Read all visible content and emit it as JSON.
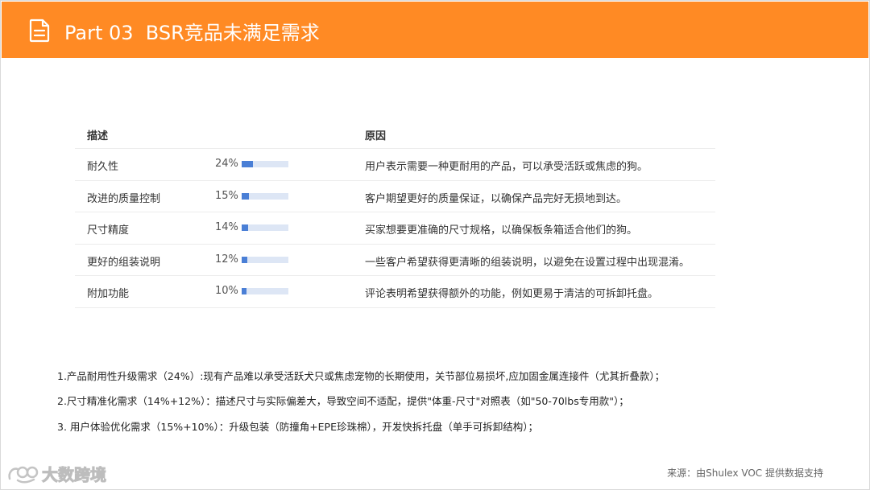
{
  "header": {
    "title": "Part 03  BSR竞品未满足需求"
  },
  "table": {
    "headers": {
      "description": "描述",
      "reason": "原因"
    },
    "rows": [
      {
        "name": "耐久性",
        "percent_label": "24%",
        "fraction": 0.24,
        "reason": "用户表示需要一种更耐用的产品，可以承受活跃或焦虑的狗。"
      },
      {
        "name": "改进的质量控制",
        "percent_label": "15%",
        "fraction": 0.15,
        "reason": "客户期望更好的质量保证，以确保产品完好无损地到达。"
      },
      {
        "name": "尺寸精度",
        "percent_label": "14%",
        "fraction": 0.14,
        "reason": "买家想要更准确的尺寸规格，以确保板条箱适合他们的狗。"
      },
      {
        "name": "更好的组装说明",
        "percent_label": "12%",
        "fraction": 0.12,
        "reason": "一些客户希望获得更清晰的组装说明，以避免在设置过程中出现混淆。"
      },
      {
        "name": "附加功能",
        "percent_label": "10%",
        "fraction": 0.1,
        "reason": "评论表明希望获得额外的功能，例如更易于清洁的可拆卸托盘。"
      }
    ]
  },
  "notes": [
    "1.产品耐用性升级需求（24%）:现有产品难以承受活跃犬只或焦虑宠物的长期使用，关节部位易损坏,应加固金属连接件（尤其折叠款）；",
    "2.尺寸精准化需求（14%+12%）：描述尺寸与实际偏差大，导致空间不适配，提供\"体重-尺寸\"对照表（如\"50-70lbs专用款\"）；",
    "3. 用户体验优化需求（15%+10%）：升级包装（防撞角+EPE珍珠棉），开发快拆托盘（单手可拆卸结构）；"
  ],
  "footer": {
    "logo_text": "大数跨境",
    "source": "来源：由Shulex VOC 提供数据支持"
  },
  "colors": {
    "header_bg": "#ff8a24",
    "bar_fill": "#4a7fd6",
    "bar_track": "#dde6f5"
  },
  "icons": {
    "header": "document-icon",
    "logo": "brand-logo-icon"
  }
}
